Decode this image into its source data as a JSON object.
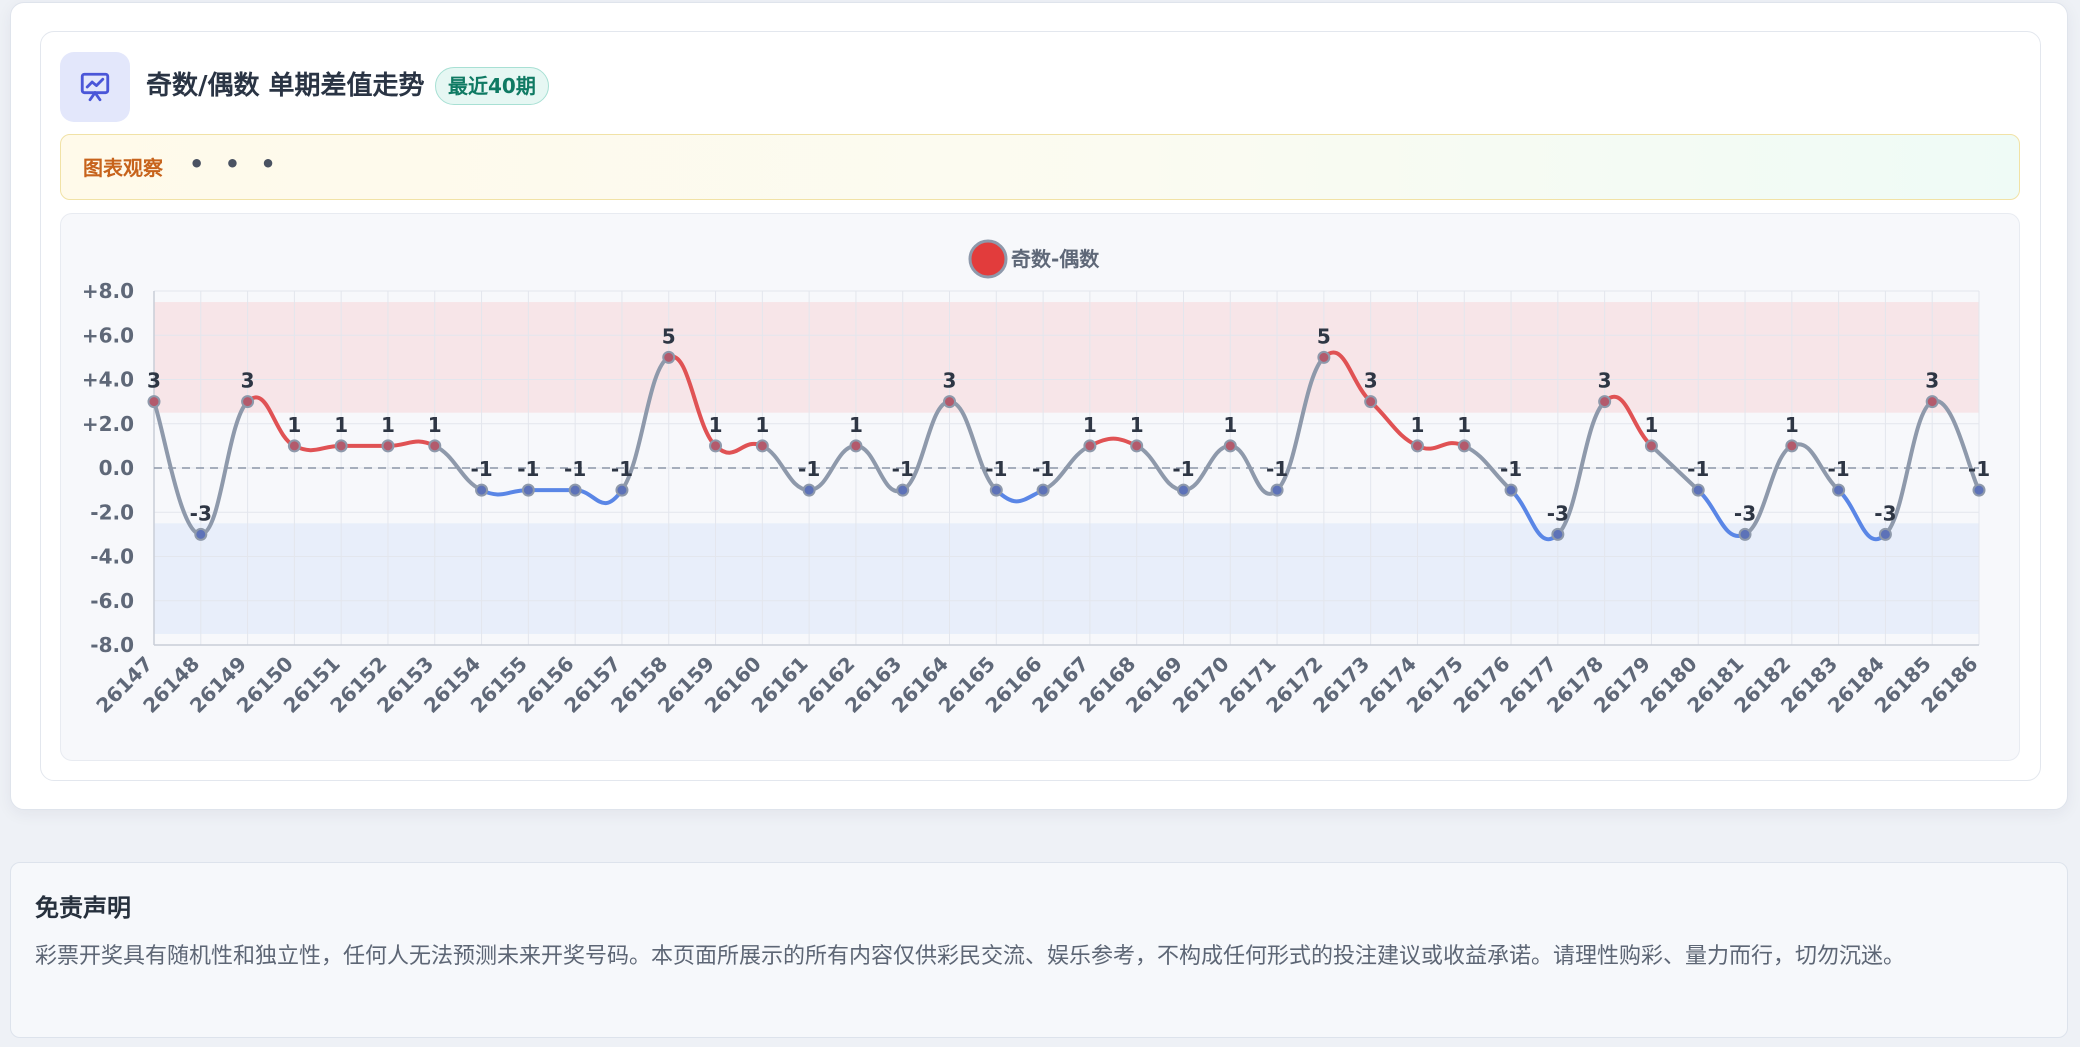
{
  "header": {
    "title": "奇数/偶数 单期差值走势",
    "badge": "最近40期",
    "icon": "presentation-chart-icon"
  },
  "observation": {
    "label": "图表观察",
    "dots": "• • •"
  },
  "chart_data": {
    "type": "line",
    "categories": [
      "26147",
      "26148",
      "26149",
      "26150",
      "26151",
      "26152",
      "26153",
      "26154",
      "26155",
      "26156",
      "26157",
      "26158",
      "26159",
      "26160",
      "26161",
      "26162",
      "26163",
      "26164",
      "26165",
      "26166",
      "26167",
      "26168",
      "26169",
      "26170",
      "26171",
      "26172",
      "26173",
      "26174",
      "26175",
      "26176",
      "26177",
      "26178",
      "26179",
      "26180",
      "26181",
      "26182",
      "26183",
      "26184",
      "26185",
      "26186"
    ],
    "series": [
      {
        "name": "奇数-偶数",
        "values": [
          3,
          -3,
          3,
          1,
          1,
          1,
          1,
          -1,
          -1,
          -1,
          -1,
          5,
          1,
          1,
          -1,
          1,
          -1,
          3,
          -1,
          -1,
          1,
          1,
          -1,
          1,
          -1,
          5,
          3,
          1,
          1,
          -1,
          -3,
          3,
          1,
          -1,
          -3,
          1,
          -1,
          -3,
          3,
          -1
        ]
      }
    ],
    "ylim": [
      -8,
      8
    ],
    "yticks": [
      "+8.0",
      "+6.0",
      "+4.0",
      "+2.0",
      "0.0",
      "-2.0",
      "-4.0",
      "-6.0",
      "-8.0"
    ],
    "grid": true,
    "legend": "top-center",
    "bands": [
      {
        "from": 2.5,
        "to": 7.5,
        "color": "#f7e5e8"
      },
      {
        "from": -7.5,
        "to": -2.5,
        "color": "#e8eefa"
      }
    ],
    "colors": {
      "positive": "#e05254",
      "negative": "#5a86e6",
      "neutral": "#8e99ab",
      "legend_marker": "#e23c3c"
    }
  },
  "disclaimer": {
    "title": "免责声明",
    "text": "彩票开奖具有随机性和独立性，任何人无法预测未来开奖号码。本页面所展示的所有内容仅供彩民交流、娱乐参考，不构成任何形式的投注建议或收益承诺。请理性购彩、量力而行，切勿沉迷。"
  }
}
